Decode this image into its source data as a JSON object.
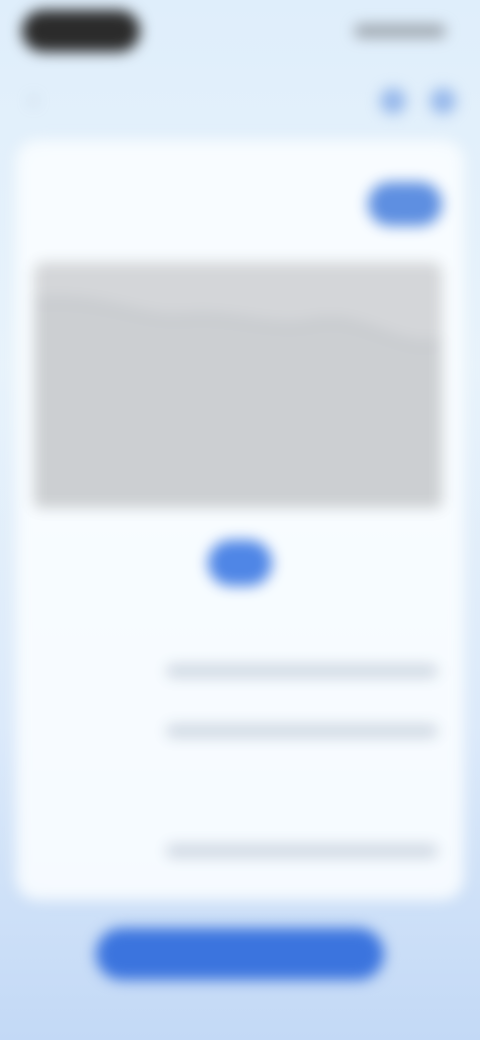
{
  "theme": {
    "accent": "#3b74de",
    "up_color": "#ea5a64"
  },
  "nav": {
    "title": "",
    "back_icon": "chevron-left-icon",
    "icons": [
      "share-icon",
      "more-icon"
    ]
  },
  "header": {
    "price_label": "",
    "sub_label": "",
    "follow_label": ""
  },
  "range": {
    "left_label": "",
    "mid_label": "",
    "right_label": ""
  },
  "quotes": [
    {
      "title": "",
      "sub": "",
      "red": "",
      "pct": ""
    },
    {
      "title": "",
      "sub": "",
      "red": "",
      "pct": ""
    },
    {
      "title": "",
      "sub": "",
      "red": "",
      "pct": ""
    }
  ],
  "footer": {
    "left_label": "",
    "right_label": "",
    "cta_label": ""
  }
}
